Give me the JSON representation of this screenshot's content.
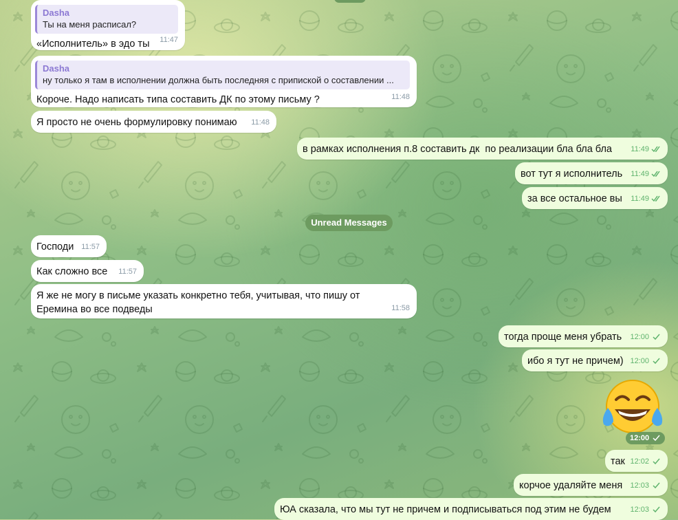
{
  "colors": {
    "incoming_bubble": "#ffffff",
    "outgoing_bubble": "#effdde",
    "reply_accent": "#9b88d8",
    "time_green": "#5fb36d",
    "service_pill": "#6d9b60"
  },
  "icons": {
    "read": "double-check-icon",
    "sent": "single-check-icon",
    "emoji": "face-with-tears-of-joy-emoji"
  },
  "messages": [
    {
      "direction": "in",
      "reply": {
        "author": "Dasha",
        "text": "Ты на меня расписал?"
      },
      "text": "«Исполнитель» в эдо ты",
      "time": "11:47"
    },
    {
      "direction": "in",
      "reply": {
        "author": "Dasha",
        "text": "ну только я там в исполнении должна быть последняя с припиской о составлении ..."
      },
      "text": "Короче. Надо написать типа составить ДК по этому письму ?",
      "time": "11:48"
    },
    {
      "direction": "in",
      "text": "Я просто не очень формулировку понимаю",
      "time": "11:48"
    },
    {
      "direction": "out",
      "text": "в рамках исполнения п.8 составить дк  по реализации бла бла бла",
      "time": "11:49",
      "status": "read"
    },
    {
      "direction": "out",
      "text": "вот тут я исполнитель",
      "time": "11:49",
      "status": "read"
    },
    {
      "direction": "out",
      "text": "за все остальное вы",
      "time": "11:49",
      "status": "read"
    },
    {
      "direction": "in",
      "text": "Господи",
      "time": "11:57"
    },
    {
      "direction": "in",
      "text": "Как сложно все",
      "time": "11:57"
    },
    {
      "direction": "in",
      "text": "Я же не могу в письме указать конкретно тебя, учитывая, что пишу от\nЕремина во все подведы",
      "time": "11:58"
    },
    {
      "direction": "out",
      "text": "тогда проще меня убрать",
      "time": "12:00",
      "status": "sent"
    },
    {
      "direction": "out",
      "text": "ибо я тут не причем)",
      "time": "12:00",
      "status": "sent"
    },
    {
      "direction": "out",
      "text": "",
      "emoji": "😂",
      "time": "12:00",
      "status": "sent"
    },
    {
      "direction": "out",
      "text": "так",
      "time": "12:02",
      "status": "sent"
    },
    {
      "direction": "out",
      "text": "корчое удаляйте меня",
      "time": "12:03",
      "status": "sent"
    },
    {
      "direction": "out",
      "text": "ЮА сказала, что мы тут не причем и подписываться под этим не будем",
      "time": "12:03",
      "status": "sent"
    }
  ],
  "unread_divider": "Unread Messages"
}
